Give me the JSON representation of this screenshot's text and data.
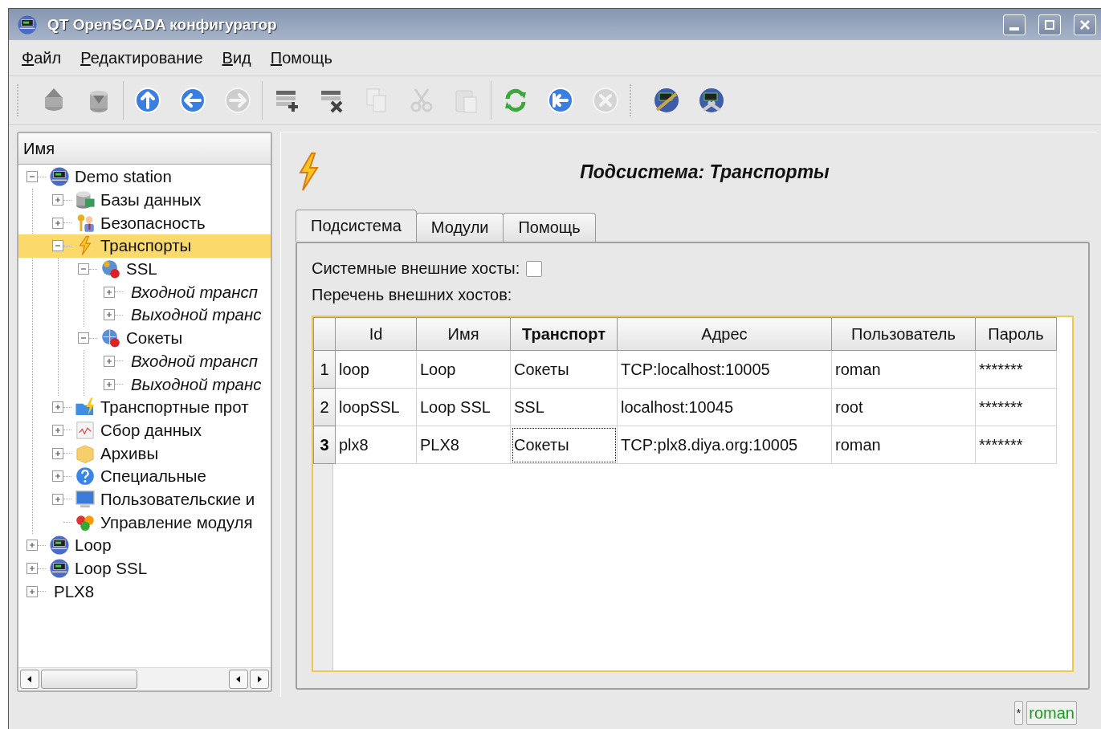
{
  "window": {
    "title": "QT OpenSCADA конфигуратор"
  },
  "menu": [
    {
      "label": "Файл"
    },
    {
      "label": "Редактирование"
    },
    {
      "label": "Вид"
    },
    {
      "label": "Помощь"
    }
  ],
  "toolbar": [
    [
      {
        "kind": "db-load",
        "disabled": false
      },
      {
        "kind": "db-save",
        "disabled": false
      }
    ],
    [
      {
        "kind": "up",
        "disabled": false
      },
      {
        "kind": "back",
        "disabled": false
      },
      {
        "kind": "forward",
        "disabled": true
      }
    ],
    [
      {
        "kind": "add",
        "disabled": false
      },
      {
        "kind": "delete",
        "disabled": false
      },
      {
        "kind": "copy",
        "disabled": true
      },
      {
        "kind": "cut",
        "disabled": true
      },
      {
        "kind": "paste",
        "disabled": true
      }
    ],
    [
      {
        "kind": "refresh",
        "disabled": false
      },
      {
        "kind": "start",
        "disabled": false
      },
      {
        "kind": "stop",
        "disabled": true
      }
    ],
    [
      {
        "kind": "station-tool",
        "disabled": false
      },
      {
        "kind": "station-config",
        "disabled": false
      }
    ]
  ],
  "tree": {
    "header": "Имя",
    "items": [
      {
        "label": "Demo station",
        "kind": "station",
        "expanded": true,
        "selected": false,
        "children": [
          {
            "label": "Базы данных",
            "kind": "database",
            "expanded": false,
            "selected": false
          },
          {
            "label": "Безопасность",
            "kind": "security",
            "expanded": false,
            "selected": false
          },
          {
            "label": "Транспорты",
            "kind": "transport",
            "expanded": true,
            "selected": true,
            "children": [
              {
                "label": "SSL",
                "kind": "module-ssl",
                "expanded": true,
                "selected": false,
                "children": [
                  {
                    "label": "Входной трансп",
                    "kind": "group",
                    "expanded": false,
                    "selected": false
                  },
                  {
                    "label": "Выходной транс",
                    "kind": "group",
                    "expanded": false,
                    "selected": false
                  }
                ]
              },
              {
                "label": "Сокеты",
                "kind": "module-sockets",
                "expanded": true,
                "selected": false,
                "children": [
                  {
                    "label": "Входной трансп",
                    "kind": "group",
                    "expanded": false,
                    "selected": false
                  },
                  {
                    "label": "Выходной транс",
                    "kind": "group",
                    "expanded": false,
                    "selected": false
                  }
                ]
              }
            ]
          },
          {
            "label": "Транспортные прот",
            "kind": "protocols",
            "expanded": false,
            "selected": false
          },
          {
            "label": "Сбор данных",
            "kind": "daq",
            "expanded": false,
            "selected": false
          },
          {
            "label": "Архивы",
            "kind": "archive",
            "expanded": false,
            "selected": false
          },
          {
            "label": "Специальные",
            "kind": "special",
            "expanded": false,
            "selected": false
          },
          {
            "label": "Пользовательские и",
            "kind": "ui",
            "expanded": false,
            "selected": false
          },
          {
            "label": "Управление модуля",
            "kind": "modules",
            "selected": false
          }
        ]
      },
      {
        "label": "Loop",
        "kind": "station",
        "expanded": false,
        "selected": false
      },
      {
        "label": "Loop SSL",
        "kind": "station",
        "expanded": false,
        "selected": false
      },
      {
        "label": "PLX8",
        "kind": "plain",
        "expanded": false,
        "selected": false
      }
    ]
  },
  "page": {
    "title": "Подсистема: Транспорты",
    "tabs": [
      {
        "label": "Подсистема",
        "selected": true
      },
      {
        "label": "Модули",
        "selected": false
      },
      {
        "label": "Помощь",
        "selected": false
      }
    ],
    "system_hosts": {
      "label": "Системные внешние хосты:",
      "checked": false
    },
    "hosts_label": "Перечень внешних хостов:",
    "table": {
      "columns": [
        {
          "label": "Id",
          "selected": false
        },
        {
          "label": "Имя",
          "selected": false
        },
        {
          "label": "Транспорт",
          "selected": true
        },
        {
          "label": "Адрес",
          "selected": false
        },
        {
          "label": "Пользователь",
          "selected": false
        },
        {
          "label": "Пароль",
          "selected": false
        }
      ],
      "rows": [
        {
          "number": "1",
          "selected": false,
          "cells": [
            "loop",
            "Loop",
            "Сокеты",
            "TCP:localhost:10005",
            "roman",
            "*******"
          ]
        },
        {
          "number": "2",
          "selected": false,
          "cells": [
            "loopSSL",
            "Loop SSL",
            "SSL",
            "localhost:10045",
            "root",
            "*******"
          ]
        },
        {
          "number": "3",
          "selected": true,
          "cells": [
            "plx8",
            "PLX8",
            "Сокеты",
            "TCP:plx8.diya.org:10005",
            "roman",
            "*******"
          ]
        }
      ]
    }
  },
  "status_bar": {
    "modified": "*",
    "user": "roman"
  }
}
